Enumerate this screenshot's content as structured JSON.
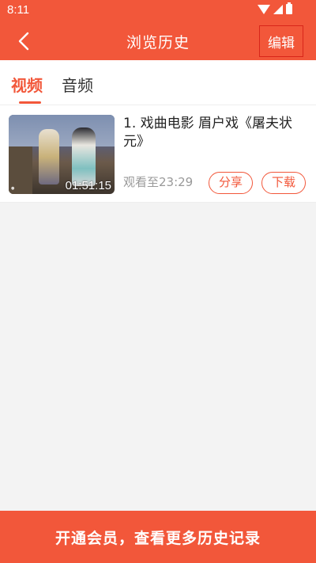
{
  "status_bar": {
    "time": "8:11"
  },
  "app_bar": {
    "title": "浏览历史",
    "edit_label": "编辑"
  },
  "tabs": [
    {
      "label": "视频",
      "selected": true
    },
    {
      "label": "音频",
      "selected": false
    }
  ],
  "history": [
    {
      "title": "1. 戏曲电影  眉户戏《屠夫状元》",
      "duration": "01:51:15",
      "progress": "观看至23:29",
      "share_label": "分享",
      "download_label": "下载"
    }
  ],
  "vip_banner": "开通会员，查看更多历史记录",
  "colors": {
    "accent": "#f2573a",
    "edit_border": "#d8261a",
    "background": "#f3f3f3"
  },
  "icons": [
    "wifi-icon",
    "signal-icon",
    "battery-icon",
    "back-arrow-icon"
  ]
}
